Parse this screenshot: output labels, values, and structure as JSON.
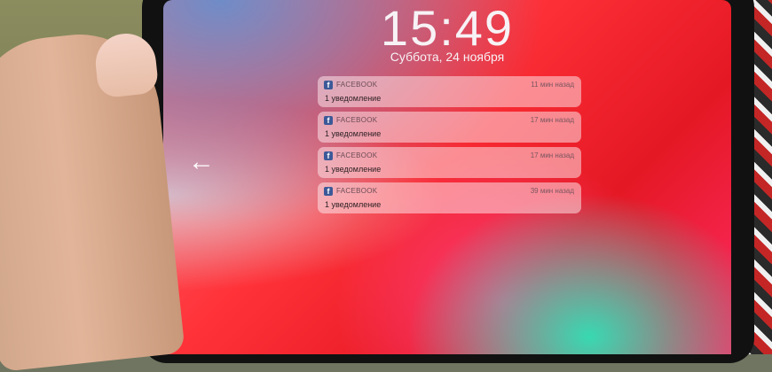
{
  "lockscreen": {
    "time": "15:49",
    "date": "Суббота, 24 ноября",
    "back_arrow_glyph": "←",
    "notifications": [
      {
        "app": "FACEBOOK",
        "time": "11 мин назад",
        "body": "1 уведомление"
      },
      {
        "app": "FACEBOOK",
        "time": "17 мин назад",
        "body": "1 уведомление"
      },
      {
        "app": "FACEBOOK",
        "time": "17 мин назад",
        "body": "1 уведомление"
      },
      {
        "app": "FACEBOOK",
        "time": "39 мин назад",
        "body": "1 уведомление"
      }
    ]
  },
  "icons": {
    "app_icon": "facebook-icon",
    "back": "back-arrow-icon"
  },
  "colors": {
    "wallpaper_red": "#ff3138",
    "wallpaper_blue": "#6f8cc8",
    "wallpaper_teal": "#38d9b2",
    "facebook_blue": "#3b5998"
  }
}
